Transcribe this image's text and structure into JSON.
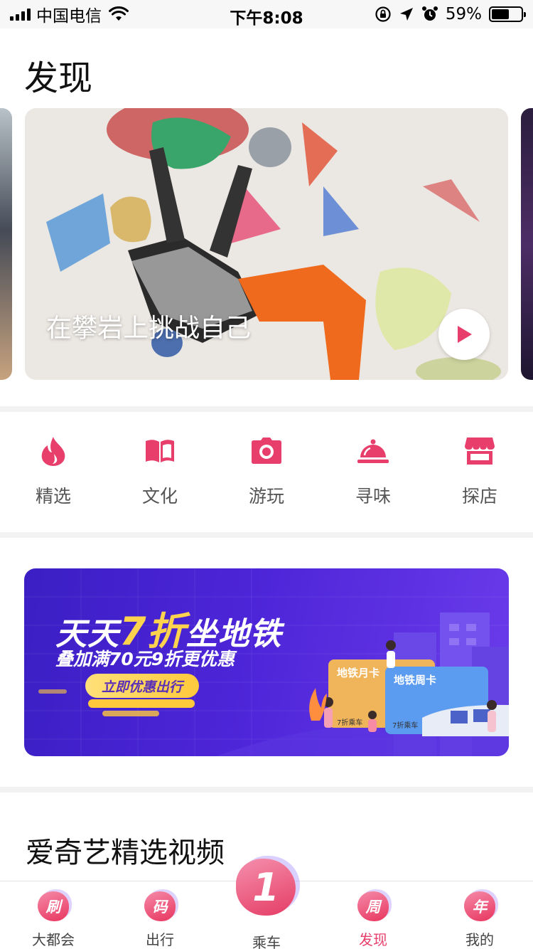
{
  "status_bar": {
    "carrier": "中国电信",
    "time": "下午8:08",
    "battery_percent": "59%",
    "battery_level": 0.59,
    "icons": [
      "signal-icon",
      "wifi-icon",
      "orientation-lock-icon",
      "location-icon",
      "alarm-icon",
      "battery-icon"
    ]
  },
  "page": {
    "title": "发现"
  },
  "carousel": {
    "active_card": {
      "caption": "在攀岩上挑战自己",
      "play_icon": "play-icon"
    }
  },
  "categories": [
    {
      "label": "精选",
      "icon": "flame-icon"
    },
    {
      "label": "文化",
      "icon": "book-icon"
    },
    {
      "label": "游玩",
      "icon": "camera-icon"
    },
    {
      "label": "寻味",
      "icon": "food-cloche-icon"
    },
    {
      "label": "探店",
      "icon": "store-icon"
    }
  ],
  "promo": {
    "title_prefix": "天天",
    "title_highlight": "7折",
    "title_suffix": "坐地铁",
    "subtitle": "叠加满70元9折更优惠",
    "button": "立即优惠出行",
    "card_monthly": "地铁月卡",
    "card_weekly": "地铁周卡",
    "card_note_1": "7折乘车",
    "card_note_2": "7折乘车"
  },
  "section": {
    "title": "爱奇艺精选视频"
  },
  "tabbar": {
    "items": [
      {
        "icon_text": "刷",
        "label": "大都会",
        "active": false
      },
      {
        "icon_text": "码",
        "label": "出行",
        "active": false
      },
      {
        "icon_text": "1",
        "label": "乘车",
        "active": false
      },
      {
        "icon_text": "周",
        "label": "发现",
        "active": true
      },
      {
        "icon_text": "年",
        "label": "我的",
        "active": false
      }
    ]
  },
  "colors": {
    "accent": "#e83e6c",
    "promo_bg": "#4d25d8",
    "promo_highlight": "#ffd34d"
  }
}
